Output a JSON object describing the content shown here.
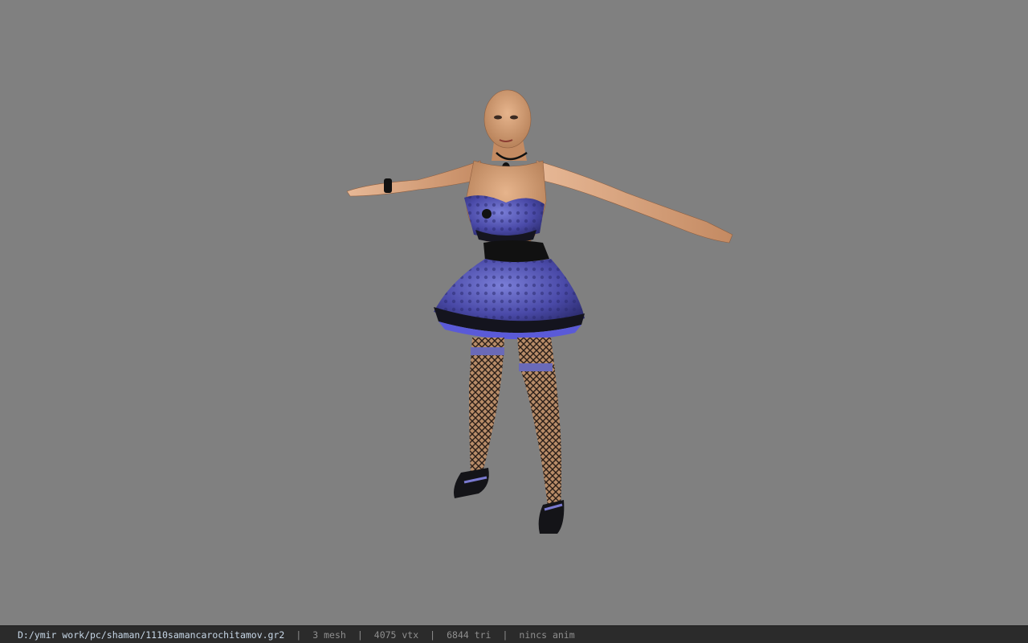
{
  "viewer": {
    "background_color": "#808080",
    "model_icon": "character-model-icon"
  },
  "status": {
    "file_path": "D:/ymir work/pc/shaman/1110samancarochitamov.gr2",
    "separator": "|",
    "mesh": "3 mesh",
    "vertices": "4075 vtx",
    "triangles": "6844 tri",
    "animation": "nincs anim"
  }
}
